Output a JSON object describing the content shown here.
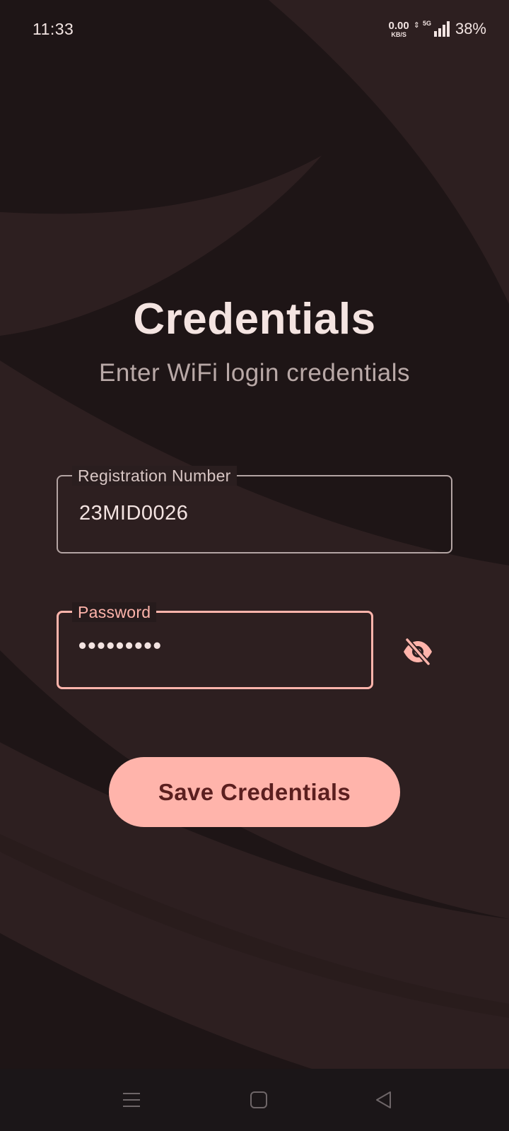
{
  "status_bar": {
    "time": "11:33",
    "net_speed_value": "0.00",
    "net_speed_unit": "KB/S",
    "network_type": "5G",
    "battery": "38%"
  },
  "header": {
    "title": "Credentials",
    "subtitle": "Enter WiFi login credentials"
  },
  "form": {
    "registration": {
      "label": "Registration Number",
      "value": "23MID0026"
    },
    "password": {
      "label": "Password",
      "value": "•••••••••",
      "visibility_icon": "eye-off-icon"
    },
    "save_label": "Save Credentials"
  },
  "nav_bar": {
    "items": [
      "menu-icon",
      "home-square-icon",
      "back-triangle-icon"
    ]
  },
  "colors": {
    "background": "#1e1516",
    "background_wave": "#2d1f20",
    "accent": "#ffb4ab",
    "button_text": "#5b1f1f",
    "title_text": "#f4e4e1",
    "subtitle_text": "#b9a9a7"
  }
}
